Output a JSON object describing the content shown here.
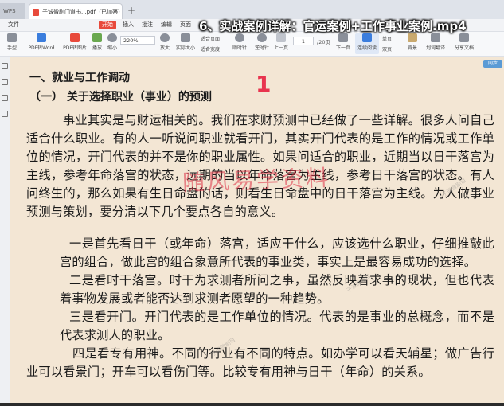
{
  "video_title": "6、实战案例详解：官运案例+工作事业案例.mp4",
  "tabs": [
    {
      "label": "WPS"
    },
    {
      "label": "子诚微剧门道书...pdf（已加密）"
    }
  ],
  "menu": [
    "文件",
    "开始",
    "插入",
    "批注",
    "编辑",
    "页面",
    "保护",
    "转换"
  ],
  "menu_active_index": 1,
  "toolbar": {
    "hand": "手型",
    "select": "选择",
    "pdf_word": "PDF转Word",
    "pdf_image": "PDF转图片",
    "play": "播放",
    "zoom_out": "缩小",
    "zoom_value": "220%",
    "zoom_in": "放大",
    "actual_size": "实际大小",
    "fit_page": "适合页面",
    "fit_width": "适合宽度",
    "rotate": "旋转文档",
    "prev": "上一页",
    "next": "下一页",
    "page_current": "1",
    "page_total": "/20页",
    "clockwise": "顺时针",
    "counterclockwise": "逆时针",
    "continuous": "连续阅读",
    "single": "单页",
    "double": "双页",
    "background": "背景",
    "split": "划词翻译",
    "share": "分享文档",
    "night": "夜间"
  },
  "right_badge": "同步",
  "document": {
    "heading1": "一、就业与工作调动",
    "heading2": "（一） 关于选择职业（事业）的预测",
    "page_marker": "1",
    "watermark": "随风易学资料",
    "small_watermark": "子诚微剧目",
    "paragraphs": [
      "事业其实是与财运相关的。我们在求财预测中已经做了一些详解。很多人问自己适合什么职业。有的人一听说问职业就看开门，其实开门代表的是工作的情况或工作单位的情况，开门代表的并不是你的职业属性。如果问适合的职业，近期当以日干落宫为主线，参考年命落宫的状态，远期的当以年命落宫为主线，参考日干落宫的状态。有人问终生的，那么如果有生日命盘的话，则看生日命盘中的日干落宫为主线。为人做事业预测与策划，要分清以下几个要点各自的意义。",
      "一是首先看日干（或年命）落宫，适应干什么，应该选什么职业，仔细推敲此宫的组合，做此宫的组合象意所代表的事业类，事实上是最容易成功的选择。",
      "二是看时干落宫。时干为求测者所问之事，虽然反映着求事的现状，但也代表着事物发展或者能否达到求测者愿望的一种趋势。",
      "三是看开门。开门代表的是工作单位的情况。代表的是事业的总概念，而不是代表求测人的职业。",
      "四是看专有用神。不同的行业有不同的特点。如办学可以看天辅星；做广告行业可以看景门；开车可以看伤门等。比较专有用神与日干（年命）的关系。"
    ]
  }
}
